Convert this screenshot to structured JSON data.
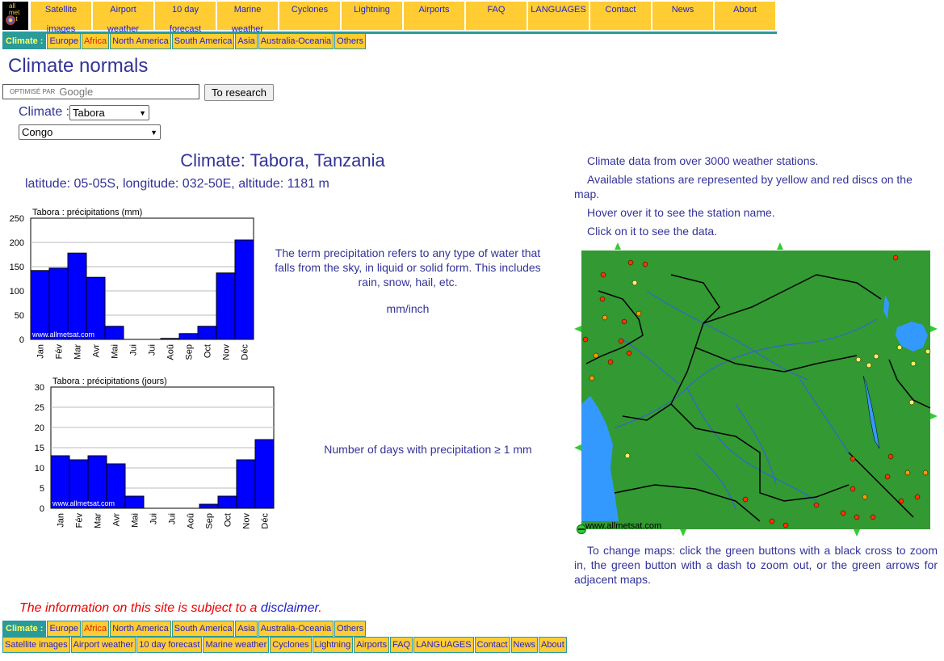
{
  "nav": {
    "items": [
      "Satellite images",
      "Airport weather",
      "10 day forecast",
      "Marine weather",
      "Cyclones",
      "Lightning",
      "Airports",
      "FAQ",
      "LANGUAGES",
      "Contact",
      "News",
      "About"
    ],
    "nav_lines": [
      [
        "Satellite",
        "images"
      ],
      [
        "Airport",
        "weather"
      ],
      [
        "10 day",
        "forecast"
      ],
      [
        "Marine",
        "weather"
      ],
      [
        "Cyclones"
      ],
      [
        "Lightning"
      ],
      [
        "Airports"
      ],
      [
        "FAQ"
      ],
      [
        "LANGUAGES"
      ],
      [
        "Contact"
      ],
      [
        "News"
      ],
      [
        "About"
      ]
    ]
  },
  "logo": {
    "line1": "all",
    "line2": "met",
    "line3": "sat"
  },
  "regions": {
    "label": "Climate :",
    "items": [
      "Europe",
      "Africa",
      "North America",
      "South America",
      "Asia",
      "Australia-Oceania",
      "Others"
    ]
  },
  "page_title": "Climate normals",
  "search": {
    "google_label": "OPTIMISÉ PAR",
    "google_word": "Google",
    "button": "To research"
  },
  "climate_label": "Climate :",
  "station_select": "Tabora",
  "country_select": "Congo",
  "station": {
    "title": "Climate: Tabora, Tanzania",
    "coords": "latitude: 05-05S, longitude: 032-50E, altitude: 1181 m"
  },
  "precip_text": "The term precipitation refers to any type of water that falls from the sky, in liquid or solid form. This includes rain, snow, hail, etc.",
  "unit_link": "mm/inch",
  "days_text": "Number of days with precipitation ≥ 1 mm",
  "right_texts": [
    "Climate data from over 3000 weather stations.",
    "Available stations are represented by yellow and red discs on the map.",
    "Hover over it to see the station name.",
    "Click on it to see the data."
  ],
  "map_watermark": "www.allmetsat.com",
  "map_help": "To change maps: click the green buttons with a black cross to zoom in, the green button with a dash to zoom out, or the green arrows for adjacent maps.",
  "disclaimer": {
    "text": "The information on this site is subject to a ",
    "link": "disclaimer",
    "end": "."
  },
  "bottom_nav": [
    "Satellite images",
    "Airport weather",
    "10 day forecast",
    "Marine weather",
    "Cyclones",
    "Lightning",
    "Airports",
    "FAQ",
    "LANGUAGES",
    "Contact",
    "News",
    "About"
  ],
  "colors": {
    "bar": "#0000ff",
    "nav_bg": "#ffcc33",
    "teal": "#2a9a9a",
    "land": "#339933",
    "water": "#3399ff"
  },
  "chart_data": [
    {
      "type": "bar",
      "title": "Tabora : précipitations (mm)",
      "categories": [
        "Jan",
        "Fév",
        "Mar",
        "Avr",
        "Mai",
        "Jui",
        "Jui",
        "Aoû",
        "Sep",
        "Oct",
        "Nov",
        "Déc"
      ],
      "values": [
        142,
        147,
        178,
        128,
        27,
        0,
        0,
        2,
        12,
        27,
        137,
        205
      ],
      "ylim": [
        0,
        250
      ],
      "yticks": [
        0,
        50,
        100,
        150,
        200,
        250
      ],
      "watermark": "www.allmetsat.com",
      "grid": true
    },
    {
      "type": "bar",
      "title": "Tabora : précipitations (jours)",
      "categories": [
        "Jan",
        "Fév",
        "Mar",
        "Avr",
        "Mai",
        "Jui",
        "Jui",
        "Aoû",
        "Sep",
        "Oct",
        "Nov",
        "Déc"
      ],
      "values": [
        13,
        12,
        13,
        11,
        3,
        0,
        0,
        0,
        1,
        3,
        12,
        17
      ],
      "ylim": [
        0,
        30
      ],
      "yticks": [
        0,
        5,
        10,
        15,
        20,
        25,
        30
      ],
      "watermark": "www.allmetsat.com",
      "grid": true
    }
  ]
}
